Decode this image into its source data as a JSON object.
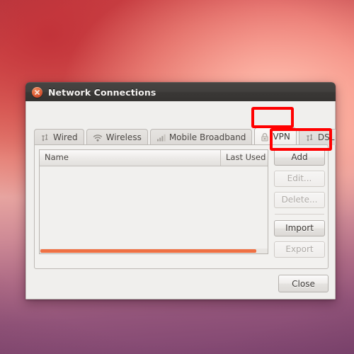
{
  "window": {
    "title": "Network Connections",
    "close_icon": "window-close-icon"
  },
  "tabs": [
    {
      "label": "Wired",
      "icon": "wired-network-icon",
      "active": false
    },
    {
      "label": "Wireless",
      "icon": "wifi-icon",
      "active": false
    },
    {
      "label": "Mobile Broadband",
      "icon": "signal-bars-icon",
      "active": false
    },
    {
      "label": "VPN",
      "icon": "lock-icon",
      "active": true
    },
    {
      "label": "DSL",
      "icon": "wired-network-icon",
      "active": false
    }
  ],
  "list": {
    "columns": [
      "Name",
      "Last Used"
    ],
    "rows": []
  },
  "buttons": {
    "add": {
      "label": "Add",
      "enabled": true
    },
    "edit": {
      "label": "Edit...",
      "enabled": false
    },
    "delete": {
      "label": "Delete...",
      "enabled": false
    },
    "import": {
      "label": "Import",
      "enabled": true
    },
    "export": {
      "label": "Export",
      "enabled": false
    },
    "close": {
      "label": "Close",
      "enabled": true
    }
  },
  "annotations": [
    {
      "target": "VPN tab",
      "color": "#ff0000"
    },
    {
      "target": "Add button",
      "color": "#ff0000"
    }
  ],
  "colors": {
    "accent_orange": "#ef7043",
    "annotation_red": "#ff0000",
    "titlebar": "#3d3b39",
    "window_bg": "#f0efed"
  }
}
